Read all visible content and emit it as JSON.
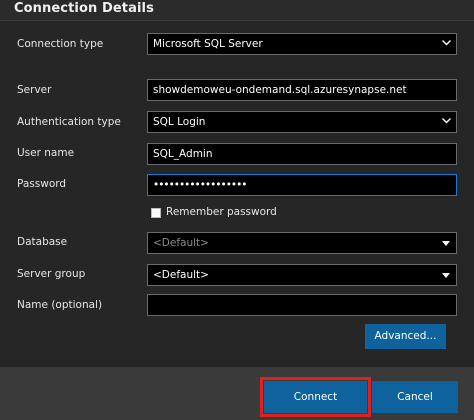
{
  "header": {
    "title": "Connection Details"
  },
  "form": {
    "connection_type": {
      "label": "Connection type",
      "value": "Microsoft SQL Server"
    },
    "server": {
      "label": "Server",
      "value": "showdemoweu-ondemand.sql.azuresynapse.net"
    },
    "auth_type": {
      "label": "Authentication type",
      "value": "SQL Login"
    },
    "user_name": {
      "label": "User name",
      "value": "SQL_Admin"
    },
    "password": {
      "label": "Password",
      "value": "••••••••••••••••••"
    },
    "remember_password": {
      "label": "Remember password",
      "checked": false
    },
    "database": {
      "label": "Database",
      "value": "<Default>"
    },
    "server_group": {
      "label": "Server group",
      "value": "<Default>"
    },
    "name_optional": {
      "label": "Name (optional)",
      "value": ""
    },
    "advanced_label": "Advanced..."
  },
  "footer": {
    "connect_label": "Connect",
    "cancel_label": "Cancel"
  },
  "colors": {
    "accent": "#0e639c",
    "focus_border": "#0f7fd8",
    "highlight": "#e0201c"
  },
  "icons": {
    "dropdown": "chevron-down-icon",
    "database_dropdown": "caret-down-icon",
    "checkbox": "checkbox-icon"
  }
}
